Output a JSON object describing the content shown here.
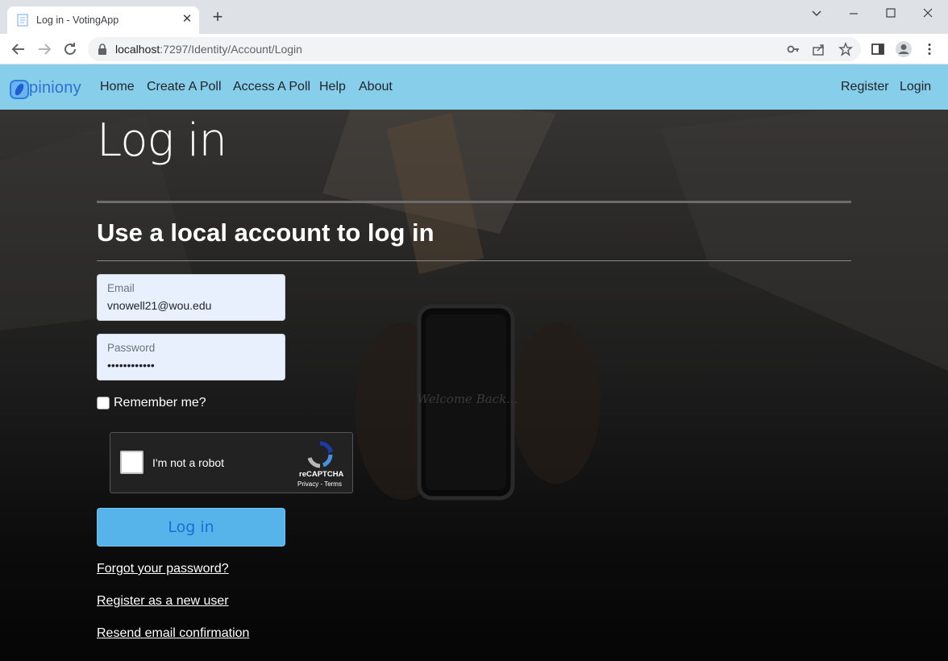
{
  "browser": {
    "tab_title": "Log in - VotingApp",
    "url_host": "localhost",
    "url_path": ":7297/Identity/Account/Login"
  },
  "navbar": {
    "brand": "piniony",
    "links": [
      "Home",
      "Create A Poll",
      "Access A Poll",
      "Help",
      "About"
    ],
    "right_links": [
      "Register",
      "Login"
    ],
    "color": "#87ceeb"
  },
  "main": {
    "title": "Log in",
    "subtitle": "Use a local account to log in",
    "email": {
      "label": "Email",
      "value": "vnowell21@wou.edu"
    },
    "password": {
      "label": "Password",
      "value": "••••••••••••"
    },
    "remember_label": "Remember me?",
    "captcha": {
      "label": "I'm not a robot",
      "brand": "reCAPTCHA",
      "links": "Privacy - Terms"
    },
    "login_button": "Log in",
    "forgot_link": "Forgot your password?",
    "register_link": "Register as a new user",
    "resend_link": "Resend email confirmation",
    "accent": "#56b4ea"
  }
}
